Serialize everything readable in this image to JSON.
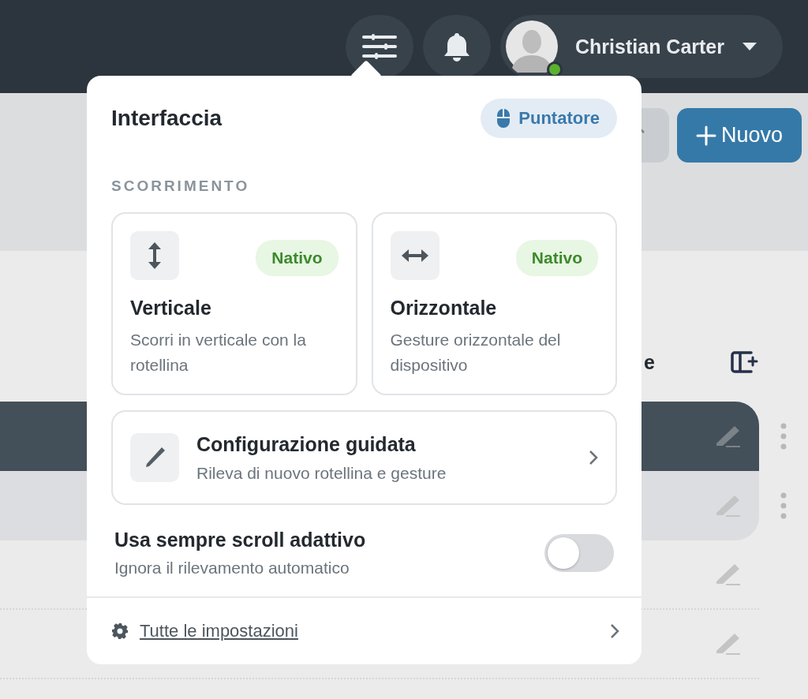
{
  "topbar": {
    "user_name": "Christian Carter",
    "online": true
  },
  "toolbar": {
    "new_button": "Nuovo"
  },
  "table": {
    "header_fragment": "e",
    "rows": [
      {
        "selected": true,
        "highlighted": false
      },
      {
        "selected": false,
        "highlighted": true
      },
      {
        "selected": false,
        "highlighted": false
      },
      {
        "selected": false,
        "highlighted": false
      }
    ]
  },
  "popover": {
    "title": "Interfaccia",
    "input_mode": "Puntatore",
    "section": "SCORRIMENTO",
    "options": [
      {
        "kind": "vertical",
        "title": "Verticale",
        "description": "Scorri in verticale con la rotellina",
        "badge": "Nativo"
      },
      {
        "kind": "horizontal",
        "title": "Orizzontale",
        "description": "Gesture orizzontale del dispositivo",
        "badge": "Nativo"
      }
    ],
    "wizard": {
      "title": "Configurazione guidata",
      "subtitle": "Rileva di nuovo rotellina e gesture"
    },
    "adaptive_scroll": {
      "label": "Usa sempre scroll adattivo",
      "hint": "Ignora il rilevamento automatico",
      "on": false
    },
    "settings_link": "Tutte le impostazioni"
  }
}
